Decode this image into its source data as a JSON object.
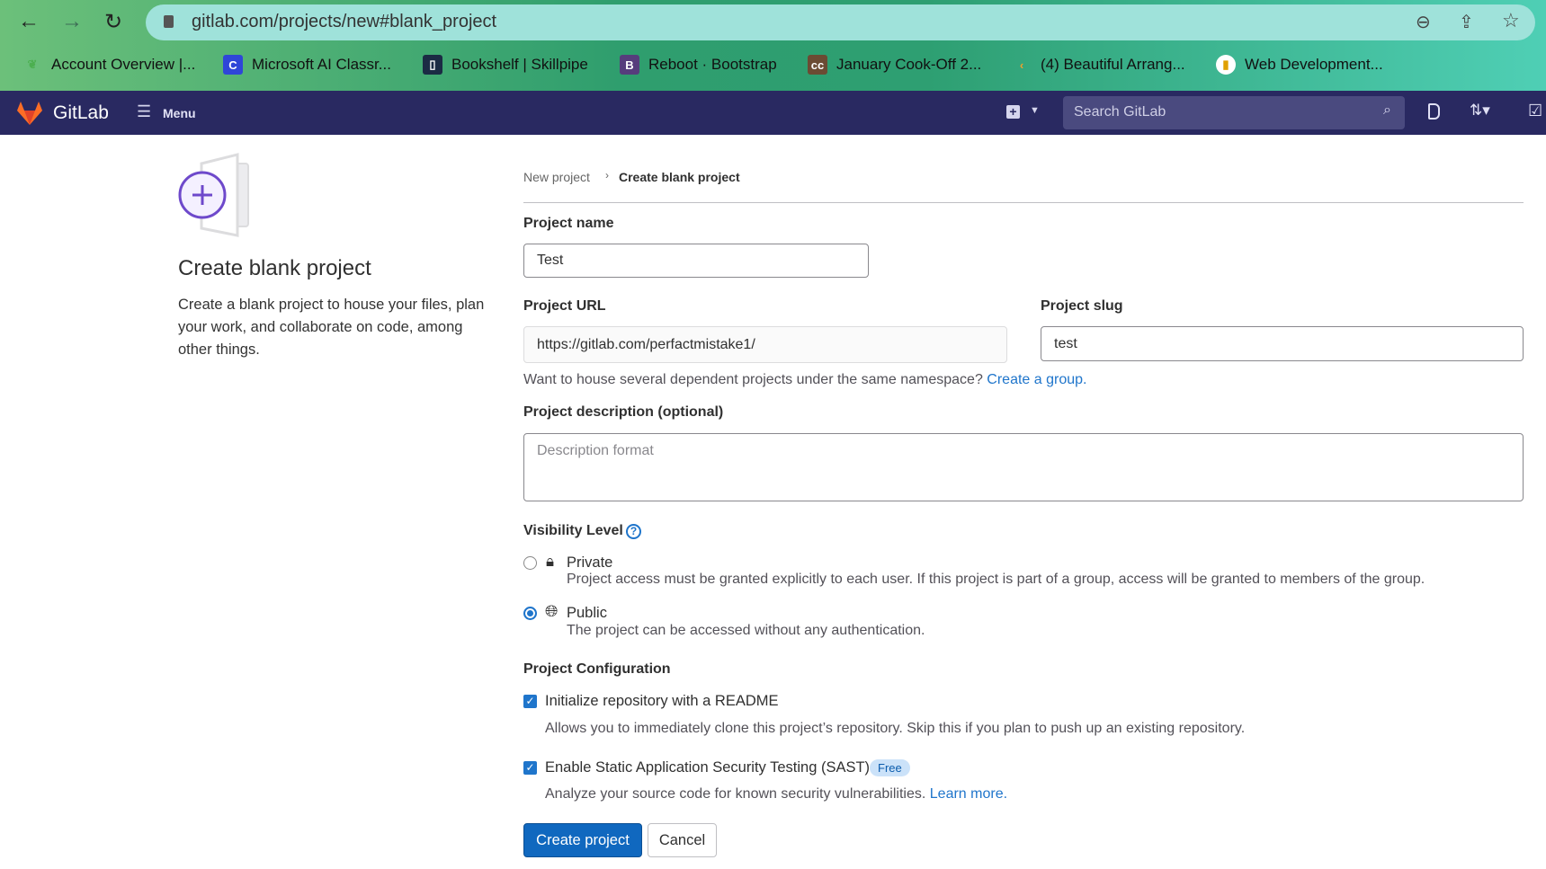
{
  "browser": {
    "url": "gitlab.com/projects/new#blank_project",
    "bookmarks": [
      {
        "label": "Account Overview |...",
        "icon": "leaf-icon",
        "color": "#4caf50"
      },
      {
        "label": "Microsoft AI Classr...",
        "icon": "classroom-icon",
        "color": "#2f46d8"
      },
      {
        "label": "Bookshelf | Skillpipe",
        "icon": "book-icon",
        "color": "#1b2b44"
      },
      {
        "label": "Reboot · Bootstrap",
        "icon": "bootstrap-icon",
        "color": "#563d7c"
      },
      {
        "label": "January Cook-Off 2...",
        "icon": "codechef-icon",
        "color": "#6b4b33"
      },
      {
        "label": "(4) Beautiful Arrang...",
        "icon": "leetcode-icon",
        "color": "#f0a02b"
      },
      {
        "label": "Web Development...",
        "icon": "web-dev-icon",
        "color": "#ffffff"
      }
    ]
  },
  "nav": {
    "brand": "GitLab",
    "menu": "Menu",
    "search_placeholder": "Search GitLab"
  },
  "intro": {
    "title": "Create blank project",
    "description": "Create a blank project to house your files, plan your work, and collaborate on code, among other things."
  },
  "breadcrumb": {
    "parent": "New project",
    "current": "Create blank project"
  },
  "form": {
    "name_label": "Project name",
    "name_value": "Test",
    "url_label": "Project URL",
    "url_value": "https://gitlab.com/perfactmistake1/",
    "slug_label": "Project slug",
    "slug_value": "test",
    "namespace_help": "Want to house several dependent projects under the same namespace?",
    "create_group": "Create a group.",
    "desc_label": "Project description (optional)",
    "desc_placeholder": "Description format",
    "visibility_label": "Visibility Level",
    "private_label": "Private",
    "private_desc": "Project access must be granted explicitly to each user. If this project is part of a group, access will be granted to members of the group.",
    "public_label": "Public",
    "public_desc": "The project can be accessed without any authentication.",
    "selected_visibility": "Public",
    "config_label": "Project Configuration",
    "readme_label": "Initialize repository with a README",
    "readme_desc": "Allows you to immediately clone this project’s repository. Skip this if you plan to push up an existing repository.",
    "readme_checked": true,
    "sast_label": "Enable Static Application Security Testing (SAST)",
    "sast_badge": "Free",
    "sast_desc": "Analyze your source code for known security vulnerabilities.",
    "learn_more": "Learn more.",
    "sast_checked": true,
    "create_button": "Create project",
    "cancel_button": "Cancel"
  }
}
